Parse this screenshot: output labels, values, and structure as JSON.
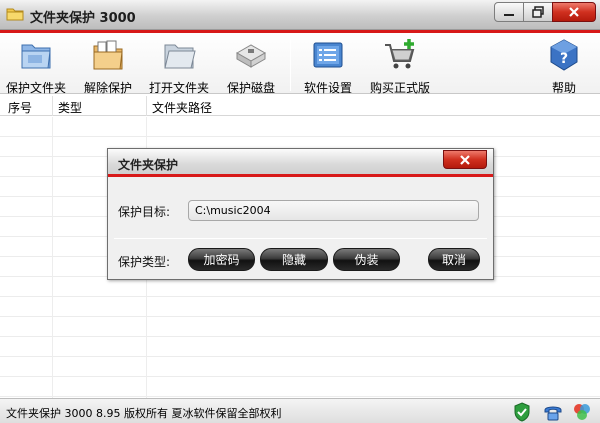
{
  "window": {
    "title": "文件夹保护 3000"
  },
  "toolbar": {
    "items": [
      {
        "label": "保护文件夹",
        "icon": "folder-protect-icon"
      },
      {
        "label": "解除保护",
        "icon": "folder-unprotect-icon"
      },
      {
        "label": "打开文件夹",
        "icon": "folder-open-icon"
      },
      {
        "label": "保护磁盘",
        "icon": "disk-icon"
      },
      {
        "label": "软件设置",
        "icon": "settings-icon"
      },
      {
        "label": "购买正式版",
        "icon": "cart-icon"
      },
      {
        "label": "帮助",
        "icon": "help-icon"
      }
    ]
  },
  "list": {
    "columns": [
      "序号",
      "类型",
      "文件夹路径"
    ]
  },
  "dialog": {
    "title": "文件夹保护",
    "target_label": "保护目标:",
    "target_value": "C:\\music2004",
    "type_label": "保护类型:",
    "buttons": {
      "encrypt": "加密码",
      "hide": "隐藏",
      "disguise": "伪装",
      "cancel": "取消"
    }
  },
  "status": {
    "text": "文件夹保护 3000 8.95 版权所有 夏冰软件保留全部权利"
  },
  "colors": {
    "accent": "#d81919",
    "close": "#c8281a"
  }
}
